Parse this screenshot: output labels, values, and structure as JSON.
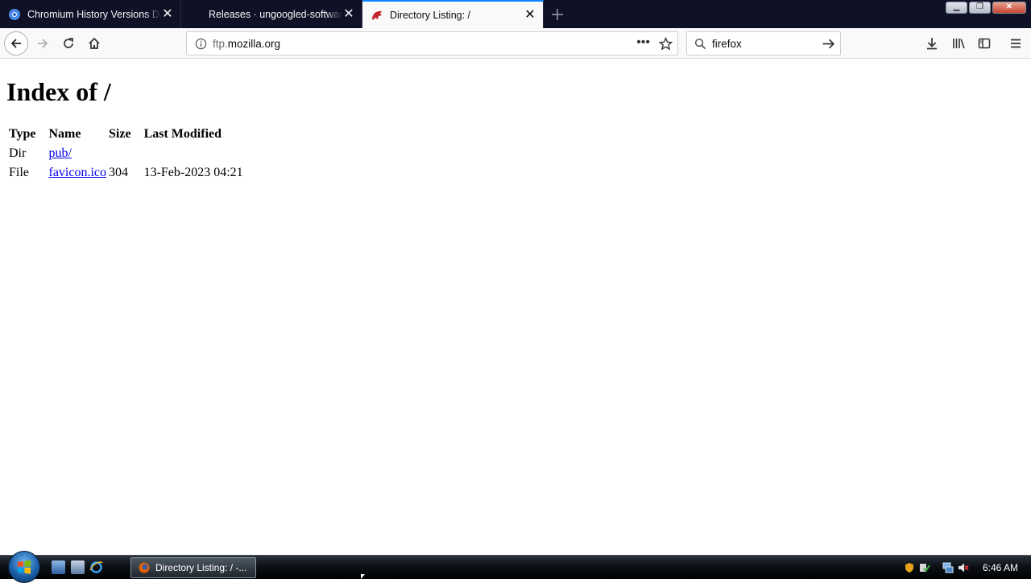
{
  "browser": {
    "tabs": [
      {
        "title": "Chromium History Versions Download",
        "favicon": "chromium-icon",
        "active": false
      },
      {
        "title": "Releases · ungoogled-software/ungoogled-chromium",
        "favicon": "github-icon",
        "active": false
      },
      {
        "title": "Directory Listing: /",
        "favicon": "mozilla-dino-icon",
        "active": true
      }
    ],
    "url_host_prefix": "ftp.",
    "url_host": "mozilla.org",
    "search_value": "firefox"
  },
  "page": {
    "heading": "Index of /",
    "columns": [
      "Type",
      "Name",
      "Size",
      "Last Modified"
    ],
    "rows": [
      {
        "type": "Dir",
        "name": "pub/",
        "size": "",
        "modified": ""
      },
      {
        "type": "File",
        "name": "favicon.ico",
        "size": "304",
        "modified": "13-Feb-2023 04:21"
      }
    ]
  },
  "taskbar": {
    "task_label": "Directory Listing: / -...",
    "clock": "6:46 AM"
  },
  "colors": {
    "tabstrip": "#0f1126",
    "active_tab_accent": "#0a84ff",
    "link": "#0000ee"
  }
}
